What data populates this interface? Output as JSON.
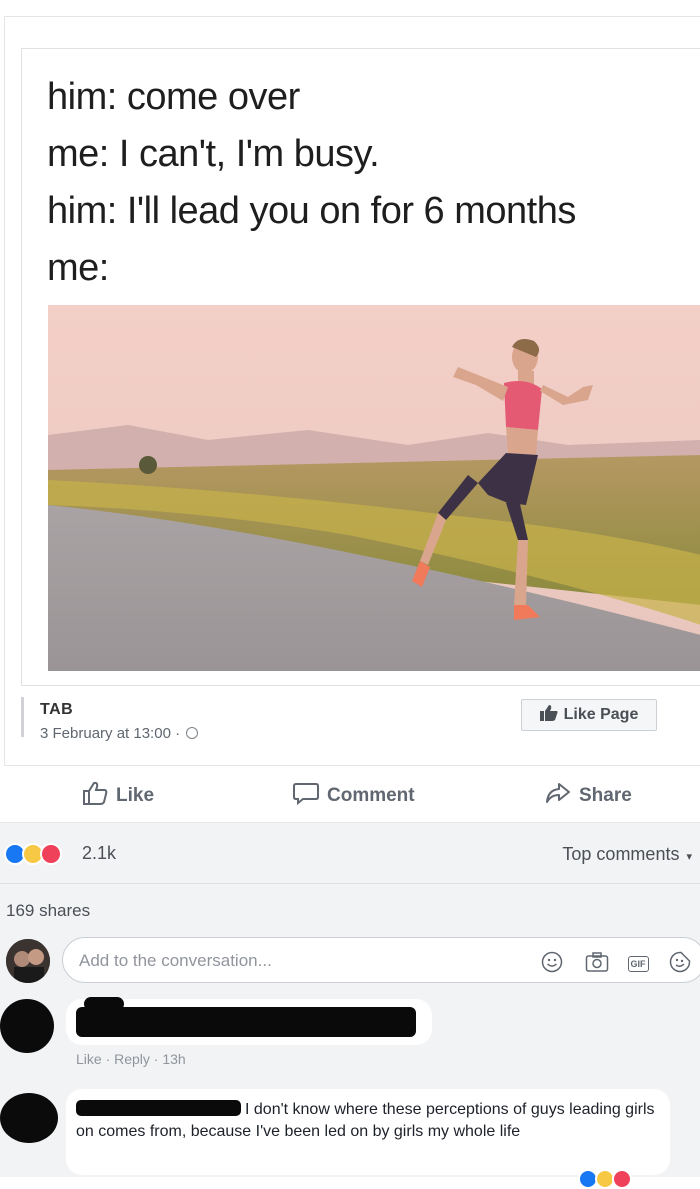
{
  "meme": {
    "lines": [
      "him: come over",
      "me: I can't, I'm busy.",
      "him: I'll lead you on for 6 months",
      "me:"
    ]
  },
  "post": {
    "page_name": "TAB",
    "date": "3 February at 13:00 ·",
    "like_page_label": "Like Page"
  },
  "actions": {
    "like": "Like",
    "comment": "Comment",
    "share": "Share"
  },
  "reactions": {
    "count": "2.1k",
    "sort_label": "Top comments"
  },
  "shares_label": "169 shares",
  "composer": {
    "placeholder": "Add to the conversation...",
    "gif_label": "GIF"
  },
  "comments": [
    {
      "meta": "Like · Reply · 13h"
    },
    {
      "text": "I don't know where these perceptions of guys leading girls on comes from, because I've been led on by girls my whole life"
    }
  ],
  "colors": {
    "like_blue": "#1877f2",
    "haha_yellow": "#f7c844",
    "love_red": "#f0415a",
    "gray_text": "#606770"
  }
}
